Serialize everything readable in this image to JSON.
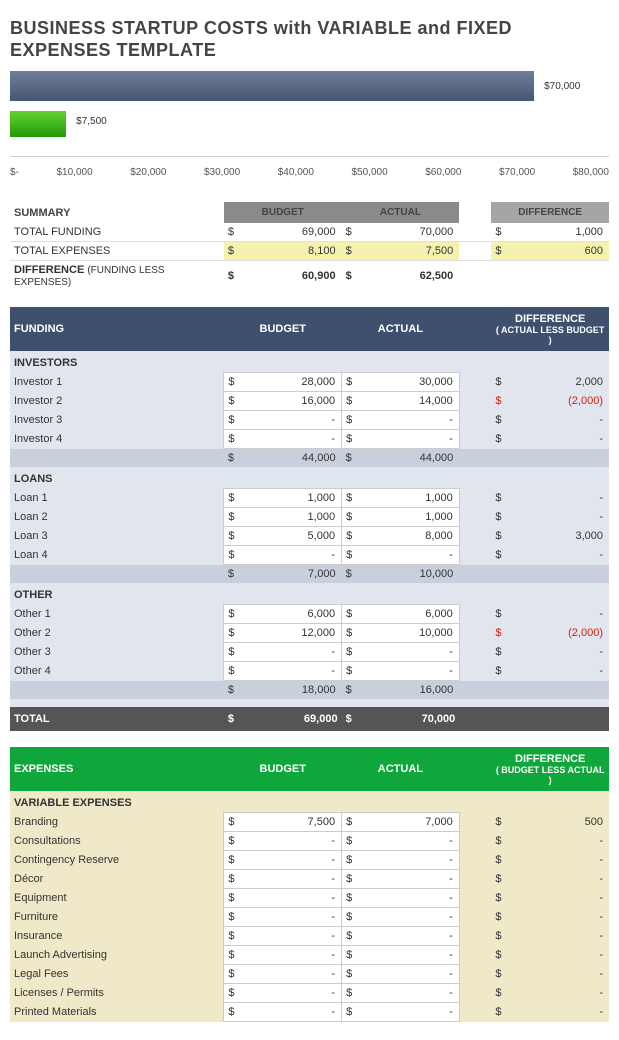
{
  "title": "BUSINESS STARTUP COSTS with VARIABLE and FIXED EXPENSES TEMPLATE",
  "chart_data": {
    "type": "bar",
    "orientation": "horizontal",
    "xlim": [
      0,
      80000
    ],
    "series": [
      {
        "name": "actual_funding",
        "value": 70000,
        "label": "$70,000",
        "color": "#596a87"
      },
      {
        "name": "actual_expenses",
        "value": 7500,
        "label": "$7,500",
        "color": "#3fb31a"
      }
    ],
    "ticks": [
      "$-",
      "$10,000",
      "$20,000",
      "$30,000",
      "$40,000",
      "$50,000",
      "$60,000",
      "$70,000",
      "$80,000"
    ]
  },
  "summary": {
    "title": "SUMMARY",
    "col_budget": "BUDGET",
    "col_actual": "ACTUAL",
    "col_diff": "DIFFERENCE",
    "rows": [
      {
        "label": "TOTAL FUNDING",
        "budget": "69,000",
        "actual": "70,000",
        "diff": "1,000",
        "highlight": false
      },
      {
        "label": "TOTAL EXPENSES",
        "budget": "8,100",
        "actual": "7,500",
        "diff": "600",
        "highlight": true
      }
    ],
    "diffrow": {
      "label": "DIFFERENCE",
      "label2": "(FUNDING LESS EXPENSES)",
      "budget": "60,900",
      "actual": "62,500"
    }
  },
  "funding": {
    "title": "FUNDING",
    "col_budget": "BUDGET",
    "col_actual": "ACTUAL",
    "col_diff_top": "DIFFERENCE",
    "col_diff_sub": "( ACTUAL LESS BUDGET )",
    "groups": [
      {
        "name": "INVESTORS",
        "rows": [
          {
            "label": "Investor 1",
            "budget": "28,000",
            "actual": "30,000",
            "diff": "2,000",
            "neg": false
          },
          {
            "label": "Investor 2",
            "budget": "16,000",
            "actual": "14,000",
            "diff": "(2,000)",
            "neg": true
          },
          {
            "label": "Investor 3",
            "budget": "-",
            "actual": "-",
            "diff": "-",
            "neg": false
          },
          {
            "label": "Investor 4",
            "budget": "-",
            "actual": "-",
            "diff": "-",
            "neg": false
          }
        ],
        "subtotal": {
          "budget": "44,000",
          "actual": "44,000"
        }
      },
      {
        "name": "LOANS",
        "rows": [
          {
            "label": "Loan 1",
            "budget": "1,000",
            "actual": "1,000",
            "diff": "-",
            "neg": false
          },
          {
            "label": "Loan 2",
            "budget": "1,000",
            "actual": "1,000",
            "diff": "-",
            "neg": false
          },
          {
            "label": "Loan 3",
            "budget": "5,000",
            "actual": "8,000",
            "diff": "3,000",
            "neg": false
          },
          {
            "label": "Loan 4",
            "budget": "-",
            "actual": "-",
            "diff": "-",
            "neg": false
          }
        ],
        "subtotal": {
          "budget": "7,000",
          "actual": "10,000"
        }
      },
      {
        "name": "OTHER",
        "rows": [
          {
            "label": "Other 1",
            "budget": "6,000",
            "actual": "6,000",
            "diff": "-",
            "neg": false
          },
          {
            "label": "Other 2",
            "budget": "12,000",
            "actual": "10,000",
            "diff": "(2,000)",
            "neg": true
          },
          {
            "label": "Other 3",
            "budget": "-",
            "actual": "-",
            "diff": "-",
            "neg": false
          },
          {
            "label": "Other 4",
            "budget": "-",
            "actual": "-",
            "diff": "-",
            "neg": false
          }
        ],
        "subtotal": {
          "budget": "18,000",
          "actual": "16,000"
        }
      }
    ],
    "total": {
      "label": "TOTAL",
      "budget": "69,000",
      "actual": "70,000"
    }
  },
  "expenses": {
    "title": "EXPENSES",
    "col_budget": "BUDGET",
    "col_actual": "ACTUAL",
    "col_diff_top": "DIFFERENCE",
    "col_diff_sub": "( BUDGET LESS ACTUAL )",
    "group_name": "VARIABLE EXPENSES",
    "rows": [
      {
        "label": "Branding",
        "budget": "7,500",
        "actual": "7,000",
        "diff": "500"
      },
      {
        "label": "Consultations",
        "budget": "-",
        "actual": "-",
        "diff": "-"
      },
      {
        "label": "Contingency Reserve",
        "budget": "-",
        "actual": "-",
        "diff": "-"
      },
      {
        "label": "Décor",
        "budget": "-",
        "actual": "-",
        "diff": "-"
      },
      {
        "label": "Equipment",
        "budget": "-",
        "actual": "-",
        "diff": "-"
      },
      {
        "label": "Furniture",
        "budget": "-",
        "actual": "-",
        "diff": "-"
      },
      {
        "label": "Insurance",
        "budget": "-",
        "actual": "-",
        "diff": "-"
      },
      {
        "label": "Launch Advertising",
        "budget": "-",
        "actual": "-",
        "diff": "-"
      },
      {
        "label": "Legal Fees",
        "budget": "-",
        "actual": "-",
        "diff": "-"
      },
      {
        "label": "Licenses / Permits",
        "budget": "-",
        "actual": "-",
        "diff": "-"
      },
      {
        "label": "Printed Materials",
        "budget": "-",
        "actual": "-",
        "diff": "-"
      }
    ]
  }
}
